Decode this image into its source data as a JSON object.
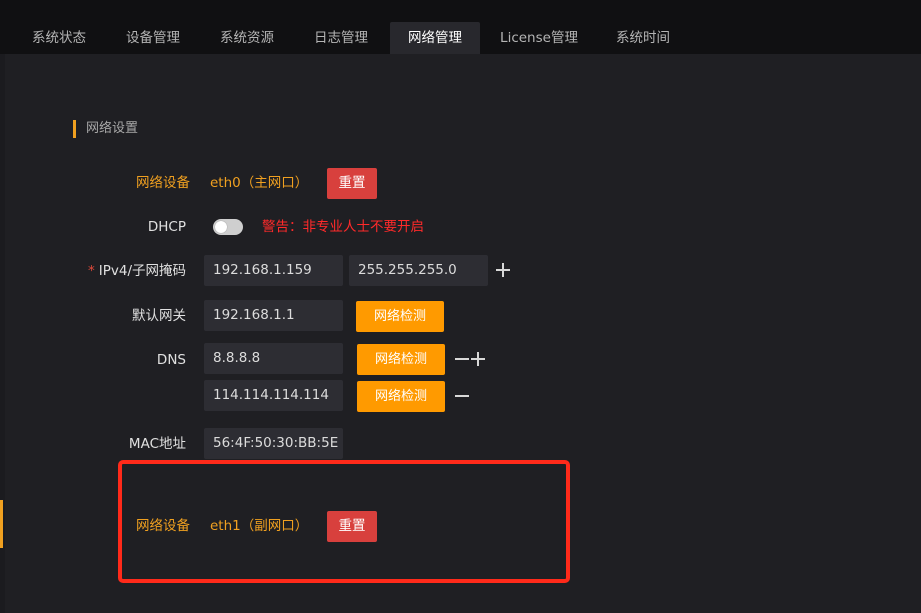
{
  "tabs": [
    {
      "label": "系统状态"
    },
    {
      "label": "设备管理"
    },
    {
      "label": "系统资源"
    },
    {
      "label": "日志管理"
    },
    {
      "label": "网络管理"
    },
    {
      "label": "License管理"
    },
    {
      "label": "系统时间"
    }
  ],
  "active_tab": "网络管理",
  "section": {
    "title": "网络设置"
  },
  "eth0": {
    "device_label": "网络设备",
    "device_value": "eth0（主网口）",
    "reset_label": "重置",
    "dhcp_label": "DHCP",
    "dhcp_enabled": false,
    "dhcp_warning": "警告：非专业人士不要开启",
    "ipv4_required_mark": "*",
    "ipv4_label": "IPv4/子网掩码",
    "ipv4_value": "192.168.1.159",
    "mask_value": "255.255.255.0",
    "gateway_label": "默认网关",
    "gateway_value": "192.168.1.1",
    "detect_label": "网络检测",
    "dns_label": "DNS",
    "dns": [
      "8.8.8.8",
      "114.114.114.114"
    ],
    "mac_label": "MAC地址",
    "mac_value": "56:4F:50:30:BB:5E"
  },
  "eth1": {
    "device_label": "网络设备",
    "device_value": "eth1（副网口）",
    "reset_label": "重置"
  },
  "icons": [
    "plus-icon",
    "minus-icon"
  ],
  "colors": {
    "accent": "#f0a020",
    "danger": "#d8403d",
    "primary_button": "#ff9a00",
    "warning_text": "#ff2a2a",
    "highlight_box": "#ff2a1a"
  }
}
